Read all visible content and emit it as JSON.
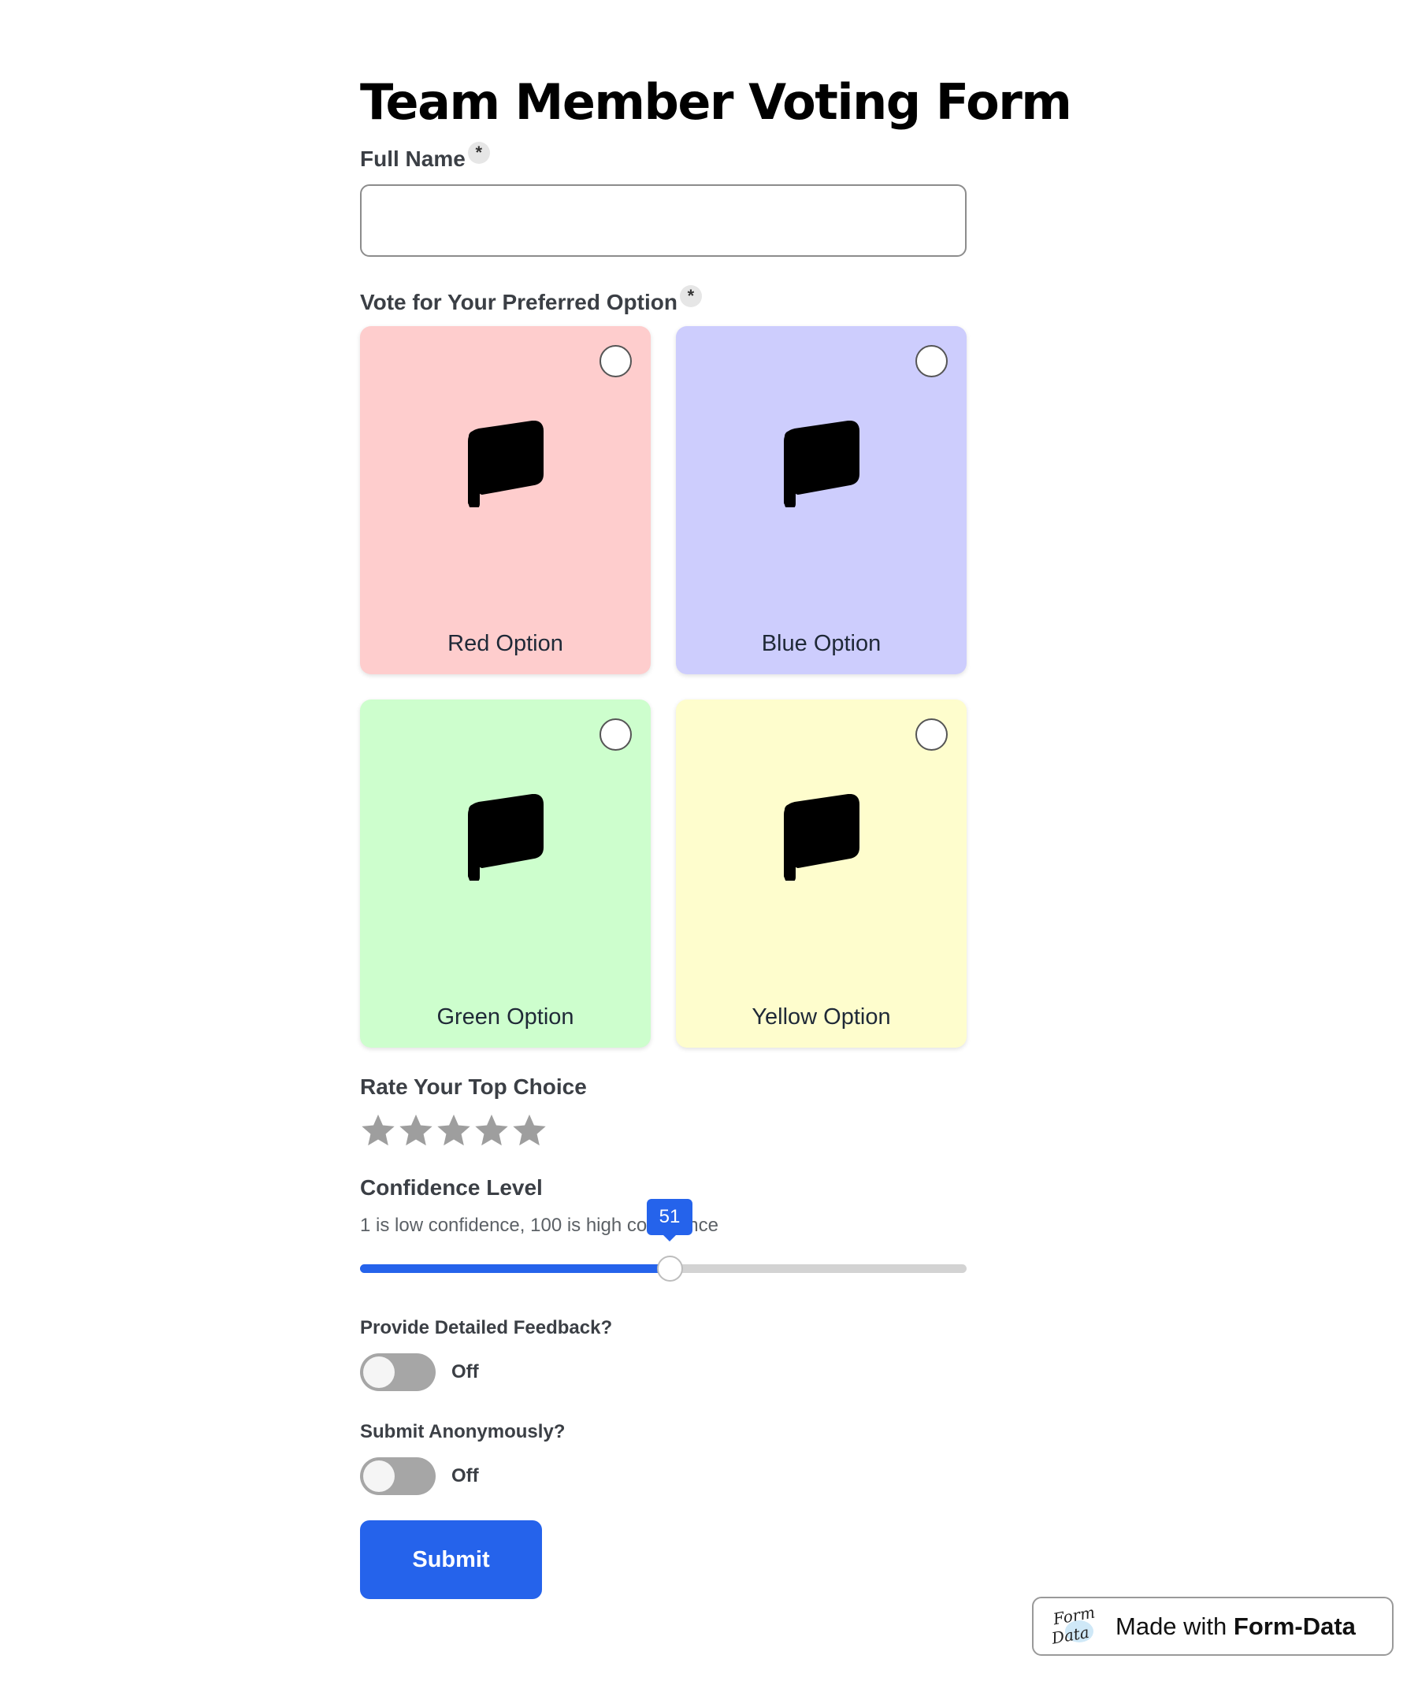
{
  "form": {
    "title": "Team Member Voting Form",
    "name_field": {
      "label": "Full Name",
      "required_mark": "*",
      "value": "",
      "placeholder": ""
    },
    "vote": {
      "label": "Vote for Your Preferred Option",
      "required_mark": "*",
      "options": [
        {
          "label": "Red Option",
          "color": "#fecdcd",
          "icon": "flag-icon",
          "selected": false
        },
        {
          "label": "Blue Option",
          "color": "#cdcdfd",
          "icon": "flag-icon",
          "selected": false
        },
        {
          "label": "Green Option",
          "color": "#cdfecd",
          "icon": "flag-icon",
          "selected": false
        },
        {
          "label": "Yellow Option",
          "color": "#fefdcd",
          "icon": "flag-icon",
          "selected": false
        }
      ]
    },
    "rating": {
      "label": "Rate Your Top Choice",
      "max_stars": 5,
      "value": 0,
      "star_color": "#9e9e9e"
    },
    "confidence": {
      "label": "Confidence Level",
      "hint": "1 is low confidence, 100 is high confidence",
      "min": 1,
      "max": 100,
      "value": 51,
      "value_label": "51",
      "accent": "#2563eb"
    },
    "feedback_toggle": {
      "label": "Provide Detailed Feedback?",
      "state": "Off"
    },
    "anonymous_toggle": {
      "label": "Submit Anonymously?",
      "state": "Off"
    },
    "submit_label": "Submit"
  },
  "badge": {
    "prefix": "Made with ",
    "brand": "Form-Data",
    "logo_text": [
      "Form",
      "Data"
    ]
  }
}
